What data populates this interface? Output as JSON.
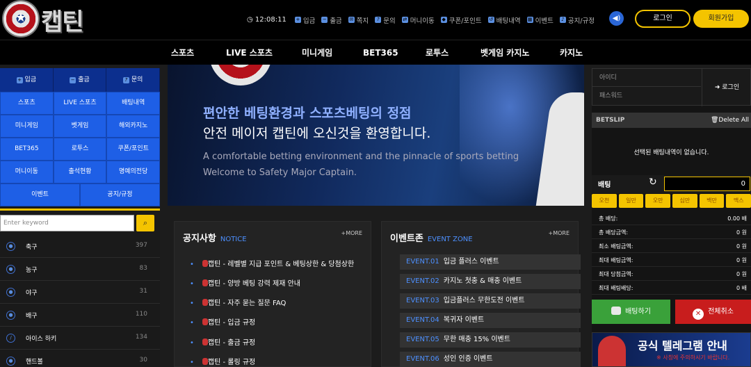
{
  "header": {
    "logo_text": "캡틴",
    "time": "12:08:11",
    "links": [
      {
        "label": "입금",
        "icon": "deposit-icon"
      },
      {
        "label": "출금",
        "icon": "withdraw-icon"
      },
      {
        "label": "쪽지",
        "icon": "message-icon"
      },
      {
        "label": "문의",
        "icon": "inquiry-icon"
      },
      {
        "label": "머니이동",
        "icon": "money-move-icon"
      },
      {
        "label": "쿠폰/포인트",
        "icon": "coupon-icon"
      },
      {
        "label": "배팅내역",
        "icon": "history-icon"
      },
      {
        "label": "이벤트",
        "icon": "calendar-icon"
      },
      {
        "label": "공지/규정",
        "icon": "notice-icon"
      }
    ],
    "login_label": "로그인",
    "join_label": "회원가입"
  },
  "nav": [
    "스포츠",
    "LIVE 스포츠",
    "미니게임",
    "BET365",
    "로투스",
    "벳게임 카지노",
    "카지노"
  ],
  "left": {
    "top": [
      "입금",
      "출금",
      "문의"
    ],
    "grid": [
      [
        "스포츠",
        "LIVE 스포츠",
        "배팅내역"
      ],
      [
        "미니게임",
        "벳게임",
        "해외카지노"
      ],
      [
        "BET365",
        "로투스",
        "쿠폰/포인트"
      ],
      [
        "머니이동",
        "출석현황",
        "명예의전당"
      ],
      [
        "이벤트",
        "공지/규정"
      ]
    ],
    "search_placeholder": "Enter keyword",
    "sports": [
      {
        "name": "축구",
        "count": "397",
        "icon": "soccer-icon"
      },
      {
        "name": "농구",
        "count": "83",
        "icon": "basketball-icon"
      },
      {
        "name": "야구",
        "count": "31",
        "icon": "baseball-icon"
      },
      {
        "name": "배구",
        "count": "110",
        "icon": "volleyball-icon"
      },
      {
        "name": "아이스 하키",
        "count": "134",
        "icon": "hockey-icon"
      },
      {
        "name": "핸드볼",
        "count": "30",
        "icon": "handball-icon"
      }
    ]
  },
  "banner": {
    "line1": "편안한 베팅환경과 스포츠베팅의 정점",
    "line2": "안전 메이저 캡틴에 오신것을 환영합니다.",
    "en1": "A comfortable betting environment and the pinnacle of sports betting",
    "en2": "Welcome to Safety Major Captain."
  },
  "notice": {
    "title": "공지사항",
    "sub": "NOTICE",
    "more": "+MORE",
    "items": [
      "캡틴 - 레벨별 지급 포인트 & 베팅상한 & 당첨상한",
      "캡틴 - 양방 베팅 강력 제재 안내",
      "캡틴 - 자주 묻는 질문 FAQ",
      "캡틴 - 입금 규정",
      "캡틴 - 출금 규정",
      "캡틴 - 롤링 규정"
    ]
  },
  "events": {
    "title": "이벤트존",
    "sub": "EVENT ZONE",
    "more": "+MORE",
    "items": [
      {
        "tag": "EVENT.01",
        "text": "입금 플러스 이벤트"
      },
      {
        "tag": "EVENT.02",
        "text": "카지노 첫충 & 매충 이벤트"
      },
      {
        "tag": "EVENT.03",
        "text": "입금플러스 무한도전 이벤트"
      },
      {
        "tag": "EVENT.04",
        "text": "복귀자 이벤트"
      },
      {
        "tag": "EVENT.05",
        "text": "무한 매충 15% 이벤트"
      },
      {
        "tag": "EVENT.06",
        "text": "성인 인증 이벤트"
      }
    ]
  },
  "right": {
    "id_placeholder": "아이디",
    "pw_placeholder": "패스워드",
    "login": "로그인",
    "betslip": "BETSLIP",
    "delete_all": "Delete All",
    "empty": "선택된 배팅내역이 없습니다.",
    "bet_label": "배팅",
    "bet_value": "0",
    "quick": [
      "오천",
      "일만",
      "오만",
      "십만",
      "백만",
      "맥스"
    ],
    "summary": [
      {
        "k": "총 배당:",
        "v": "0.00 배"
      },
      {
        "k": "총 배당금액:",
        "v": "0 원"
      },
      {
        "k": "최소 배팅금액:",
        "v": "0 원"
      },
      {
        "k": "최대 배팅금액:",
        "v": "0 원"
      },
      {
        "k": "최대 당첨금액:",
        "v": "0 원"
      },
      {
        "k": "최대 배팅배당:",
        "v": "0 배"
      }
    ],
    "bet_button": "배팅하기",
    "cancel_button": "전체취소",
    "tg_title": "공식 텔레그램 안내",
    "tg_sub": "※ 사칭에 주의하시기 바랍니다."
  }
}
